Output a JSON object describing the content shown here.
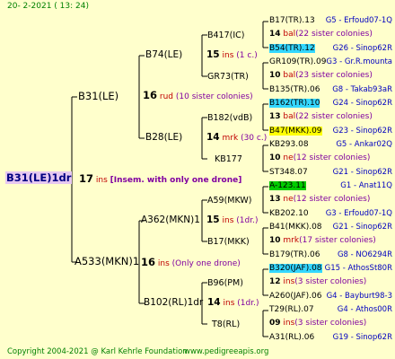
{
  "header": "20-  2-2021  ( 13: 24)",
  "footer": {
    "copyright": "Copyright 2004-2021 @ Karl Kehrle Foundation",
    "site": "www.pedigreeapis.org"
  },
  "root": {
    "name": "B31(LE)1dr",
    "year": "17",
    "ins": "ins",
    "note": "[Insem. with only one drone]"
  },
  "gen2": [
    {
      "name": "B31(LE)",
      "year": "16",
      "ins": "rud",
      "note": "(10 sister colonies)"
    },
    {
      "name": "A533(MKN)1",
      "year": "16",
      "ins": "ins",
      "note": "(Only one drone)"
    }
  ],
  "gen3": [
    {
      "name": "B74(LE)",
      "year": "15",
      "ins": "ins",
      "note": "(1 c.)"
    },
    {
      "name": "B28(LE)",
      "year": "14",
      "ins": "mrk",
      "note": "(30 c.)"
    },
    {
      "name": "A362(MKN)1",
      "year": "15",
      "ins": "ins",
      "note": "(1dr.)"
    },
    {
      "name": "B102(RL)1dr",
      "year": "14",
      "ins": "ins",
      "note": "(1dr.)"
    }
  ],
  "gen4": [
    {
      "name": "B417(IC)"
    },
    {
      "name": "GR73(TR)"
    },
    {
      "name": "B182(vdB)"
    },
    {
      "name": "KB177"
    },
    {
      "name": "A59(MKW)"
    },
    {
      "name": "B17(MKK)"
    },
    {
      "name": "B96(PM)"
    },
    {
      "name": "T8(RL)"
    }
  ],
  "gen5": [
    {
      "name": "B17(TR).13",
      "right": "G5 - Erfoud07-1Q"
    },
    {
      "yn": "14",
      "ins": "bal",
      "sc": "(22 sister colonies)"
    },
    {
      "name": "B54(TR).12",
      "right": "G26 - Sinop62R",
      "hl": "cyan"
    },
    {
      "name": "GR109(TR).09",
      "right": "G3 - Gr.R.mounta"
    },
    {
      "yn": "10",
      "ins": "bal",
      "sc": "(23 sister colonies)"
    },
    {
      "name": "B135(TR).06",
      "right": "G8 - Takab93aR"
    },
    {
      "name": "B162(TR).10",
      "right": "G24 - Sinop62R",
      "hl": "cyan"
    },
    {
      "yn": "13",
      "ins": "bal",
      "sc": "(22 sister colonies)"
    },
    {
      "name": "B47(MKK).09",
      "right": "G23 - Sinop62R",
      "hl": "yellow"
    },
    {
      "name": "KB293.08",
      "right": "G5 - Ankar02Q"
    },
    {
      "yn": "10",
      "ins": "ne",
      "sc": "(12 sister colonies)"
    },
    {
      "name": "ST348.07",
      "right": "G21 - Sinop62R"
    },
    {
      "name": "A-123.11",
      "right": "G1 - Anat11Q",
      "hl": "green"
    },
    {
      "yn": "13",
      "ins": "ne",
      "sc": "(12 sister colonies)"
    },
    {
      "name": "KB202.10",
      "right": "G3 - Erfoud07-1Q"
    },
    {
      "name": "B41(MKK).08",
      "right": "G21 - Sinop62R"
    },
    {
      "yn": "10",
      "ins": "mrk",
      "sc": "(17 sister colonies)"
    },
    {
      "name": "B179(TR).06",
      "right": "G8 - NO6294R"
    },
    {
      "name": "B320(JAF).08",
      "right": "G15 - AthosSt80R",
      "hl": "cyan"
    },
    {
      "yn": "12",
      "ins": "ins",
      "sc": "(3 sister colonies)"
    },
    {
      "name": "A260(JAF).06",
      "right": "G4 - Bayburt98-3"
    },
    {
      "name": "T29(RL).07",
      "right": "G4 - Athos00R"
    },
    {
      "yn": "09",
      "ins": "ins",
      "sc": "(3 sister colonies)"
    },
    {
      "name": "A31(RL).06",
      "right": "G19 - Sinop62R"
    }
  ],
  "colors": {
    "bg": "#ffffcc",
    "line": "#000000",
    "ins": "#c00000",
    "note": "#8000a0",
    "id": "#0000c0",
    "footer": "#008000"
  }
}
